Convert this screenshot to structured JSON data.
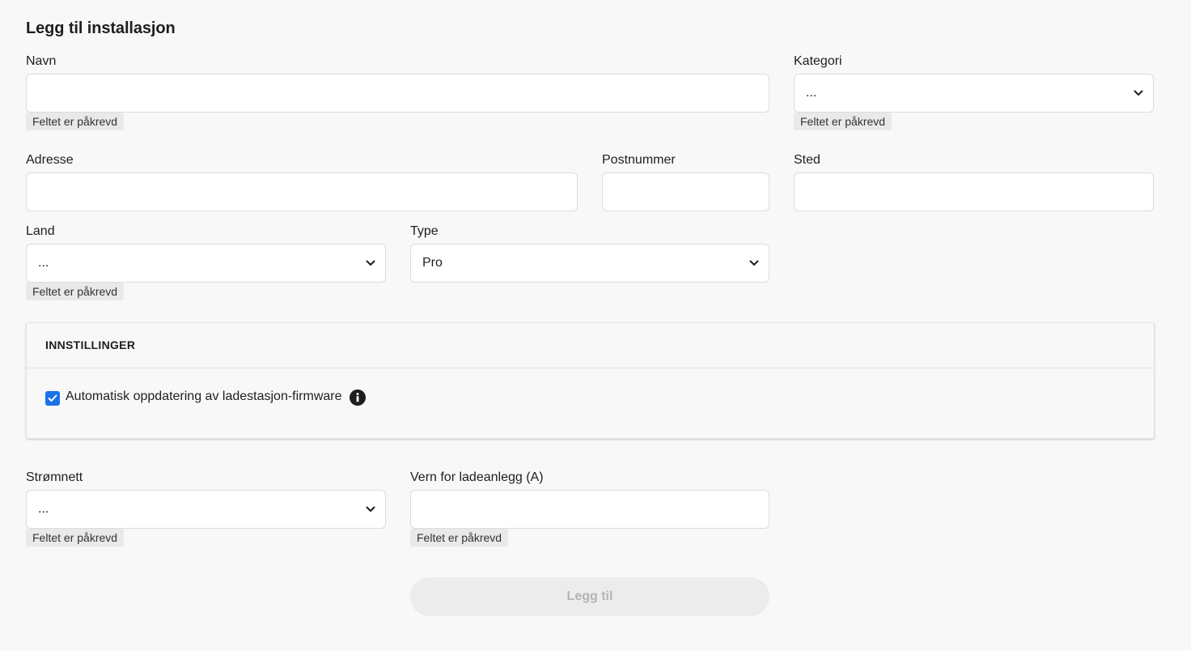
{
  "form": {
    "title": "Legg til installasjon",
    "required_hint": "Feltet er påkrevd",
    "navn": {
      "label": "Navn",
      "value": ""
    },
    "kategori": {
      "label": "Kategori",
      "value": "..."
    },
    "adresse": {
      "label": "Adresse",
      "value": ""
    },
    "postnummer": {
      "label": "Postnummer",
      "value": ""
    },
    "sted": {
      "label": "Sted",
      "value": ""
    },
    "land": {
      "label": "Land",
      "value": "..."
    },
    "type": {
      "label": "Type",
      "value": "Pro"
    },
    "stromnett": {
      "label": "Strømnett",
      "value": "..."
    },
    "vern": {
      "label": "Vern for ladeanlegg (A)",
      "value": ""
    },
    "submit_label": "Legg til"
  },
  "settings": {
    "title": "INNSTILLINGER",
    "auto_update": {
      "label": "Automatisk oppdatering av ladestasjon-firmware",
      "checked": true
    }
  },
  "icons": {
    "select_arrow": "chevron-down-icon",
    "checkbox": "checkmark-icon",
    "info": "info-icon"
  },
  "colors": {
    "background": "#f8f8f8",
    "checkbox_accent": "#1a73e8",
    "disabled_button_bg": "#ececec",
    "disabled_button_text": "#b4b4b4"
  }
}
